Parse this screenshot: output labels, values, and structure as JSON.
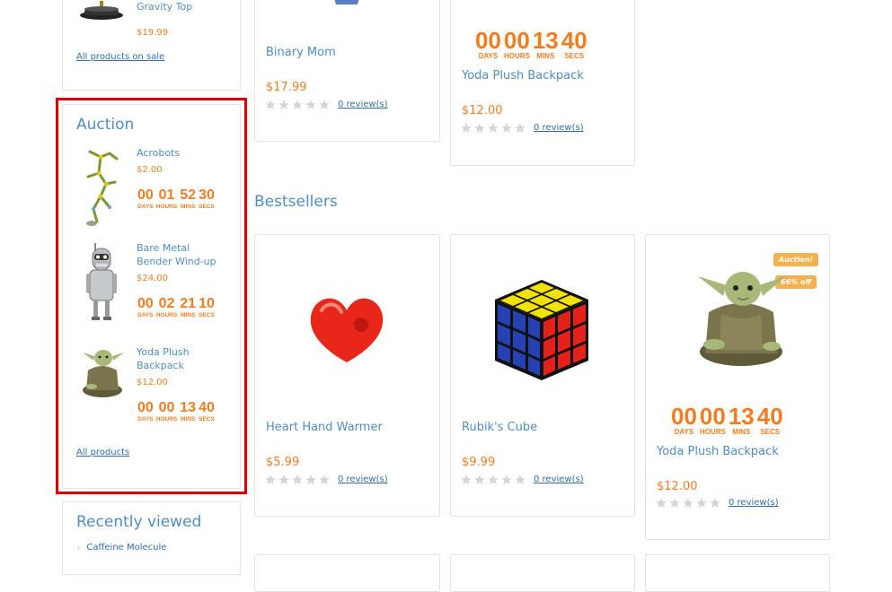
{
  "sale_box": {
    "item_name": "Levitron - Anti-Gravity Top",
    "item_price": "$19.99",
    "all_link": "All products on sale"
  },
  "auction": {
    "title": "Auction",
    "items": [
      {
        "name": "Acrobots",
        "price": "$2.00",
        "countdown": {
          "days": "00",
          "hours": "01",
          "mins": "52",
          "secs": "30"
        }
      },
      {
        "name": "Bare Metal Bender Wind-up",
        "price": "$24.00",
        "countdown": {
          "days": "00",
          "hours": "02",
          "mins": "21",
          "secs": "10"
        }
      },
      {
        "name": "Yoda Plush Backpack",
        "price": "$12.00",
        "countdown": {
          "days": "00",
          "hours": "00",
          "mins": "13",
          "secs": "40"
        }
      }
    ],
    "all_link": "All products"
  },
  "recently_viewed": {
    "title": "Recently viewed",
    "items": [
      "Caffeine Molecule"
    ]
  },
  "countdown_labels": {
    "days": "DAYS",
    "hours": "HOURS",
    "mins": "MINS",
    "secs": "SECS"
  },
  "top_products": [
    {
      "name": "Binary Mom",
      "price": "$17.99",
      "reviews": "0 review(s)"
    },
    {
      "name": "Yoda Plush Backpack",
      "price": "$12.00",
      "reviews": "0 review(s)",
      "countdown": {
        "days": "00",
        "hours": "00",
        "mins": "13",
        "secs": "40"
      }
    }
  ],
  "bestsellers": {
    "title": "Bestsellers",
    "products": [
      {
        "name": "Heart Hand Warmer",
        "price": "$5.99",
        "reviews": "0 review(s)"
      },
      {
        "name": "Rubik's Cube",
        "price": "$9.99",
        "reviews": "0 review(s)"
      },
      {
        "name": "Yoda Plush Backpack",
        "price": "$12.00",
        "reviews": "0 review(s)",
        "badges": [
          "Auction!",
          "66% off"
        ],
        "countdown": {
          "days": "00",
          "hours": "00",
          "mins": "13",
          "secs": "40"
        }
      }
    ]
  },
  "colors": {
    "accent": "#4f8dc6",
    "price": "#f47c20",
    "highlight": "#e30000",
    "star": "#d5d5d5"
  },
  "icons": [
    "star-icon",
    "bullet-arrow-icon"
  ]
}
